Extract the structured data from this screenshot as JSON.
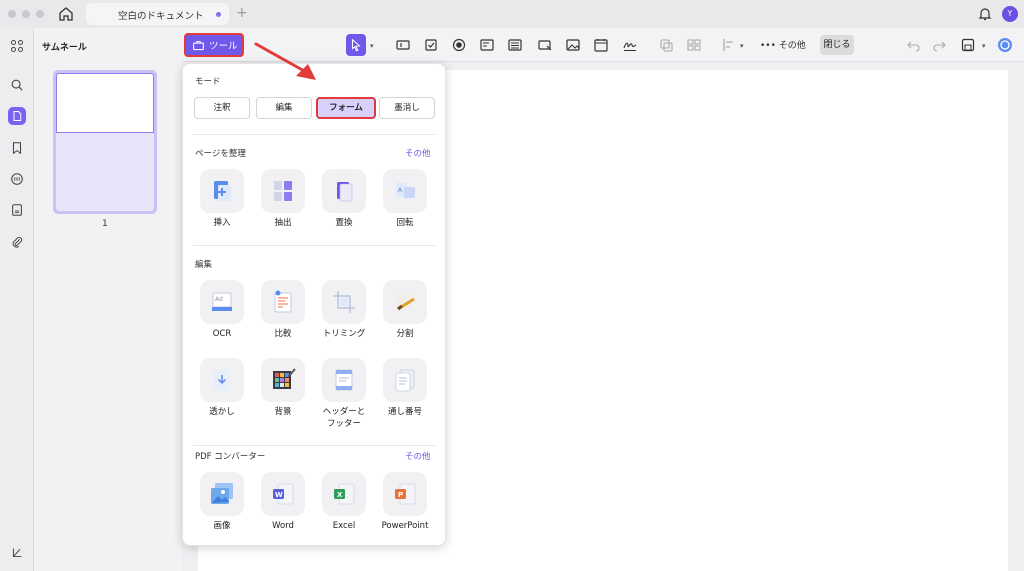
{
  "window": {
    "tab_title": "空白のドキュメント",
    "new_tab": "+",
    "avatar_initial": "Y"
  },
  "toolbar": {
    "tools_label": "ツール",
    "more_label": "••• その他",
    "close_label": "閉じる"
  },
  "thumbnails": {
    "title": "サムネール",
    "page_number": "1"
  },
  "popup": {
    "mode": {
      "title": "モード",
      "buttons": [
        "注釈",
        "編集",
        "フォーム",
        "墨消し"
      ],
      "selected": "フォーム"
    },
    "organize": {
      "title": "ページを整理",
      "more": "その他",
      "tools": [
        "挿入",
        "抽出",
        "置換",
        "回転"
      ]
    },
    "edit": {
      "title": "編集",
      "tools_row1": [
        "OCR",
        "比較",
        "トリミング",
        "分割"
      ],
      "tools_row2": [
        "透かし",
        "背景",
        "ヘッダーと\nフッター",
        "通し番号"
      ]
    },
    "converter": {
      "title": "PDF コンバーター",
      "more": "その他",
      "tools": [
        "画像",
        "Word",
        "Excel",
        "PowerPoint"
      ]
    }
  },
  "colors": {
    "accent": "#6f58ea",
    "highlight": "#e23b3b"
  }
}
